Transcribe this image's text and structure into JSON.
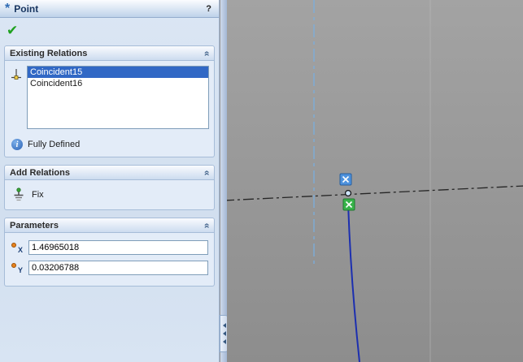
{
  "titlebar": {
    "title": "Point",
    "icon_glyph": "*",
    "help_glyph": "?"
  },
  "actions": {
    "ok_glyph": "✔"
  },
  "glyphs": {
    "chevron": "»",
    "info": "i"
  },
  "sections": {
    "existing": {
      "title": "Existing Relations",
      "items": [
        {
          "label": "Coincident15",
          "selected": true
        },
        {
          "label": "Coincident16",
          "selected": false
        }
      ],
      "status": "Fully Defined"
    },
    "add": {
      "title": "Add Relations",
      "fix_label": "Fix"
    },
    "params": {
      "title": "Parameters",
      "x": {
        "label": "X",
        "value": "1.46965018"
      },
      "y": {
        "label": "Y",
        "value": "0.03206788"
      }
    }
  },
  "colors": {
    "selection": "#3168c5",
    "panel_bg": "#d8e4f3",
    "viewport_bg": "#979797",
    "centerline_blue": "#7aaede",
    "sketch_blue": "#1c2fb0",
    "relation_badge_blue": "#4e92dd",
    "relation_badge_green": "#37b34a",
    "ok_green": "#1fa11f"
  }
}
